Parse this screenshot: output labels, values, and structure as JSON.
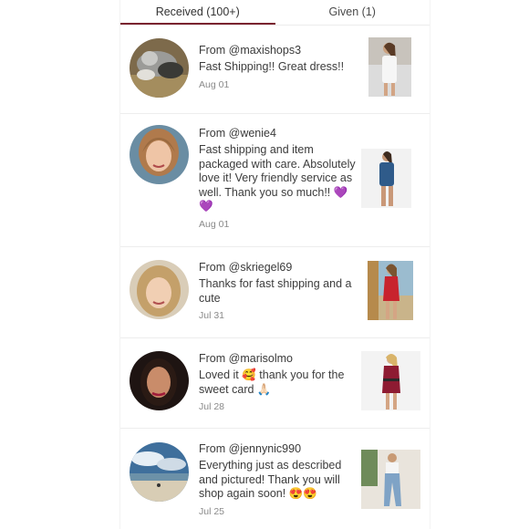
{
  "tabs": {
    "received": "Received (100+)",
    "given": "Given (1)"
  },
  "reviews": [
    {
      "from": "From @maxishops3",
      "text": "Fast Shipping!! Great dress!!",
      "date": "Aug 01"
    },
    {
      "from": "From @wenie4",
      "text": "Fast shipping and item packaged with care. Absolutely love it! Very friendly service as well. Thank you so much!! 💜💜",
      "date": "Aug 01"
    },
    {
      "from": "From @skriegel69",
      "text": "Thanks for fast shipping and a cute",
      "date": "Jul 31"
    },
    {
      "from": "From @marisolmo",
      "text": "Loved it 🥰 thank you for the sweet card 🙏🏻",
      "date": "Jul 28"
    },
    {
      "from": "From @jennynic990",
      "text": "Everything just as described and pictured! Thank you will shop again soon! 😍😍",
      "date": "Jul 25"
    }
  ],
  "colors": {
    "accent": "#7a2430",
    "divider": "#ececec",
    "text": "#3c3c3c",
    "muted": "#8a8a8a"
  }
}
